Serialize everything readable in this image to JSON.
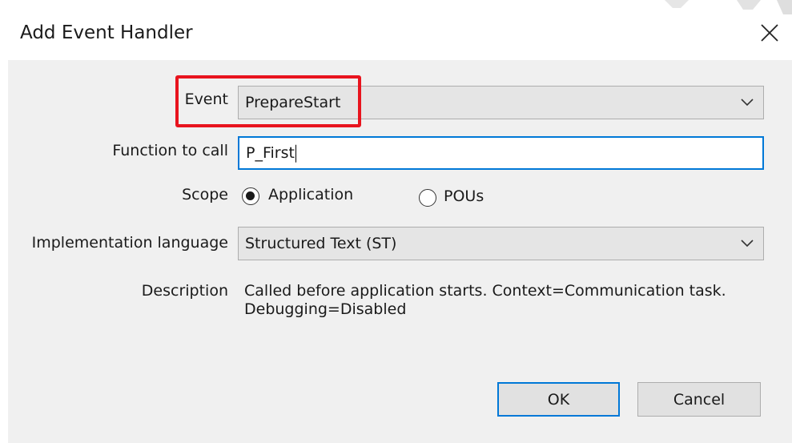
{
  "dialog": {
    "title": "Add Event Handler"
  },
  "form": {
    "event_label": "Event",
    "event_value": "PrepareStart",
    "function_label": "Function to call",
    "function_value": "P_First",
    "scope_label": "Scope",
    "scope_options": [
      {
        "label": "Application",
        "selected": true
      },
      {
        "label": "POUs",
        "selected": false
      }
    ],
    "impl_label": "Implementation language",
    "impl_value": "Structured Text (ST)",
    "description_label": "Description",
    "description_line1": "Called before application starts. Context=Communication task.",
    "description_line2": "Debugging=Disabled"
  },
  "buttons": {
    "ok_label": "OK",
    "cancel_label": "Cancel"
  },
  "icons": {
    "close": "close-icon",
    "dropdown": "chevron-down-icon"
  },
  "colors": {
    "highlight_border": "#e8141e",
    "focus_border": "#0078d7",
    "client_background": "#f0f0f0"
  }
}
